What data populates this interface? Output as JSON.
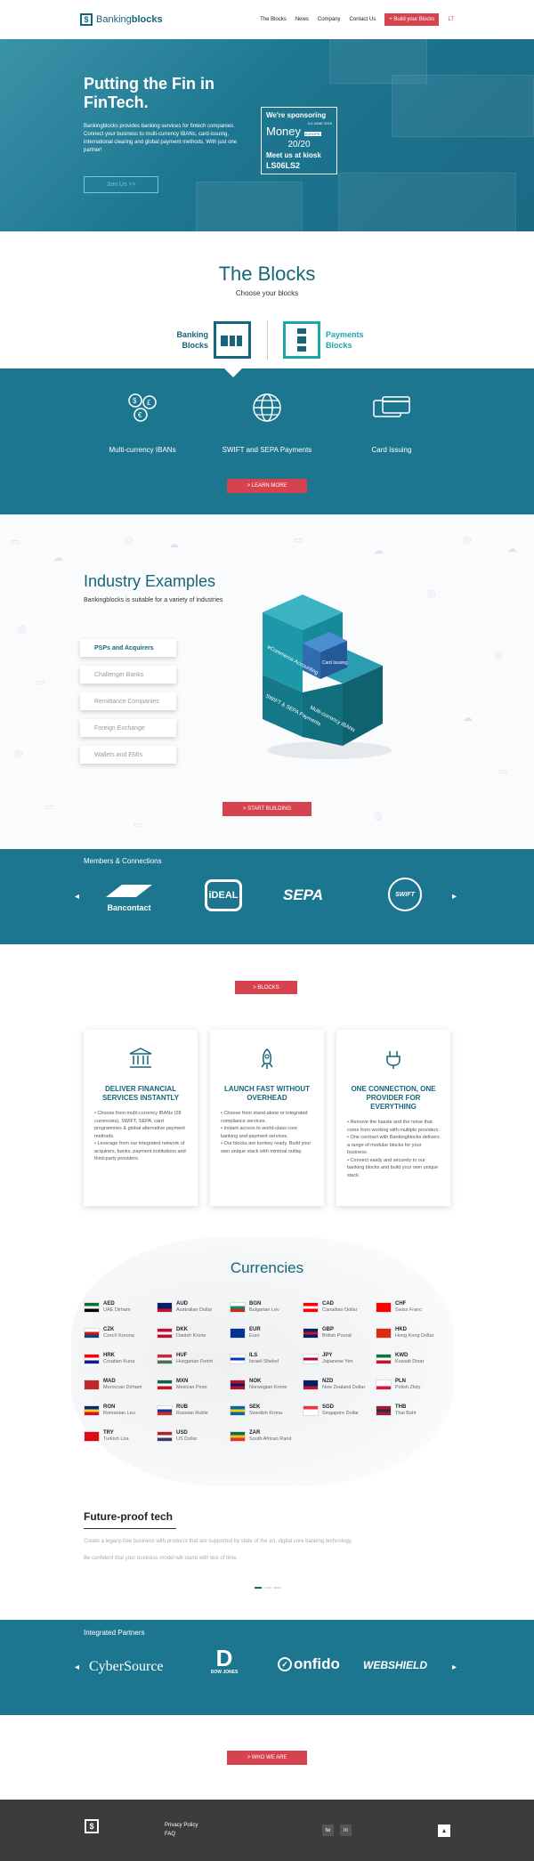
{
  "nav": {
    "logo_light": "Banking",
    "logo_bold": "blocks",
    "links": [
      "The Blocks",
      "News",
      "Company",
      "Contact Us"
    ],
    "cta": "+ Build your Blocks",
    "lang": "LT"
  },
  "hero": {
    "title": "Putting the Fin in FinTech.",
    "text": "Bankingblocks provides banking services for fintech companies. Connect your business to multi-currency IBANs, card-issuing, international clearing and global payment methods. With just one partner!",
    "button": "Join Us >>",
    "badge": {
      "line1": "We're sponsoring",
      "date": "3-6 JUNE 2019",
      "money": "Money",
      "europe": "EUROPE",
      "year": "20/20",
      "kiosk_label": "Meet us at kiosk",
      "kiosk": "LS06LS2"
    }
  },
  "blocks": {
    "title": "The Blocks",
    "subtitle": "Choose your blocks",
    "banking_label": "Banking Blocks",
    "payments_label": "Payments Blocks",
    "features": [
      {
        "label": "Multi-currency IBANs",
        "icon": "coins-icon"
      },
      {
        "label": "SWIFT and SEPA Payments",
        "icon": "globe-icon"
      },
      {
        "label": "Card Issuing",
        "icon": "cards-icon"
      }
    ],
    "learn_more": "> LEARN MORE"
  },
  "industry": {
    "title": "Industry Examples",
    "subtitle": "Bankingblocks is suitable for a variety of industries",
    "items": [
      "PSPs and Acquirers",
      "Challenger Banks",
      "Remittance Companies",
      "Foreign Exchange",
      "Wallets and EMIs"
    ],
    "cube_labels": [
      "eCommerce Accounting",
      "Card Issuing",
      "SWIFT & SEPA Payments",
      "Multi-currency IBANs"
    ],
    "start_button": "> START BUILDING"
  },
  "members": {
    "title": "Members & Connections",
    "logos": [
      "Bancontact",
      "iDEAL",
      "SEPA",
      "SWIFT"
    ]
  },
  "blocks_button": "> BLOCKS",
  "cards": [
    {
      "title": "DELIVER FINANCIAL SERVICES INSTANTLY",
      "icon": "bank-icon",
      "body": "• Choose from multi-currency IBANs (28 currencies), SWIFT, SEPA, card programmes & global alternative payment methods.\n• Leverage from our integrated network of acquirers, banks, payment institutions and third-party providers."
    },
    {
      "title": "LAUNCH FAST WITHOUT OVERHEAD",
      "icon": "rocket-icon",
      "body": "• Choose from stand-alone or integrated compliance services.\n• Instant access to world-class core banking and payment services.\n• Our blocks are turnkey ready. Build your own unique stack with minimal outlay."
    },
    {
      "title": "ONE CONNECTION, ONE PROVIDER FOR EVERYTHING",
      "icon": "plug-icon",
      "body": "• Remove the hassle and the noise that come from working with multiple providers.\n• One contract with Bankingblocks delivers a range of modular blocks for your business.\n• Connect easily and securely to our banking blocks and build your own unique stack."
    }
  ],
  "currencies": {
    "title": "Currencies",
    "list": [
      {
        "code": "AED",
        "name": "UAE Dirham",
        "c1": "#00732f",
        "c2": "#ffffff",
        "c3": "#000000"
      },
      {
        "code": "AUD",
        "name": "Australian Dollar",
        "c1": "#012169",
        "c2": "#012169",
        "c3": "#c8102e"
      },
      {
        "code": "BGN",
        "name": "Bulgarian Lev",
        "c1": "#ffffff",
        "c2": "#00966e",
        "c3": "#d62612"
      },
      {
        "code": "CAD",
        "name": "Canadian Dollar",
        "c1": "#ff0000",
        "c2": "#ffffff",
        "c3": "#ff0000"
      },
      {
        "code": "CHF",
        "name": "Swiss Franc",
        "c1": "#ff0000",
        "c2": "#ff0000",
        "c3": "#ff0000"
      },
      {
        "code": "CZK",
        "name": "Czech Koruna",
        "c1": "#ffffff",
        "c2": "#d7141a",
        "c3": "#11457e"
      },
      {
        "code": "DKK",
        "name": "Danish Krone",
        "c1": "#c60c30",
        "c2": "#ffffff",
        "c3": "#c60c30"
      },
      {
        "code": "EUR",
        "name": "Euro",
        "c1": "#003399",
        "c2": "#003399",
        "c3": "#003399"
      },
      {
        "code": "GBP",
        "name": "British Pound",
        "c1": "#012169",
        "c2": "#c8102e",
        "c3": "#012169"
      },
      {
        "code": "HKD",
        "name": "Hong Kong Dollar",
        "c1": "#de2910",
        "c2": "#de2910",
        "c3": "#de2910"
      },
      {
        "code": "HRK",
        "name": "Croatian Kuna",
        "c1": "#ff0000",
        "c2": "#ffffff",
        "c3": "#171796"
      },
      {
        "code": "HUF",
        "name": "Hungarian Forint",
        "c1": "#ce2939",
        "c2": "#ffffff",
        "c3": "#477050"
      },
      {
        "code": "ILS",
        "name": "Israeli Shekel",
        "c1": "#ffffff",
        "c2": "#0038b8",
        "c3": "#ffffff"
      },
      {
        "code": "JPY",
        "name": "Japanese Yen",
        "c1": "#ffffff",
        "c2": "#bc002d",
        "c3": "#ffffff"
      },
      {
        "code": "KWD",
        "name": "Kuwaiti Dinar",
        "c1": "#007a3d",
        "c2": "#ffffff",
        "c3": "#ce1126"
      },
      {
        "code": "MAD",
        "name": "Moroccan Dirham",
        "c1": "#c1272d",
        "c2": "#c1272d",
        "c3": "#c1272d"
      },
      {
        "code": "MXN",
        "name": "Mexican Peso",
        "c1": "#006847",
        "c2": "#ffffff",
        "c3": "#ce1126"
      },
      {
        "code": "NOK",
        "name": "Norwegian Krone",
        "c1": "#ba0c2f",
        "c2": "#00205b",
        "c3": "#ba0c2f"
      },
      {
        "code": "NZD",
        "name": "New Zealand Dollar",
        "c1": "#012169",
        "c2": "#012169",
        "c3": "#c8102e"
      },
      {
        "code": "PLN",
        "name": "Polish Zloty",
        "c1": "#ffffff",
        "c2": "#ffffff",
        "c3": "#dc143c"
      },
      {
        "code": "RON",
        "name": "Romanian Leu",
        "c1": "#002b7f",
        "c2": "#fcd116",
        "c3": "#ce1126"
      },
      {
        "code": "RUB",
        "name": "Russian Ruble",
        "c1": "#ffffff",
        "c2": "#0039a6",
        "c3": "#d52b1e"
      },
      {
        "code": "SEK",
        "name": "Swedish Krona",
        "c1": "#006aa7",
        "c2": "#fecc00",
        "c3": "#006aa7"
      },
      {
        "code": "SGD",
        "name": "Singapore Dollar",
        "c1": "#ef3340",
        "c2": "#ffffff",
        "c3": "#ffffff"
      },
      {
        "code": "THB",
        "name": "Thai Baht",
        "c1": "#a51931",
        "c2": "#2d2a4a",
        "c3": "#a51931"
      },
      {
        "code": "TRY",
        "name": "Turkish Lira",
        "c1": "#e30a17",
        "c2": "#e30a17",
        "c3": "#e30a17"
      },
      {
        "code": "USD",
        "name": "US Dollar",
        "c1": "#b22234",
        "c2": "#ffffff",
        "c3": "#3c3b6e"
      },
      {
        "code": "ZAR",
        "name": "South African Rand",
        "c1": "#007749",
        "c2": "#ffb81c",
        "c3": "#de3831"
      }
    ]
  },
  "future": {
    "title": "Future-proof tech",
    "p1": "Create a legacy-free business with products that are supported by state of the art, digital core banking technology.",
    "p2": "Be confident that your business model will stand with test of time."
  },
  "partners": {
    "title": "Integrated Partners",
    "logos": [
      "CyberSource",
      "DOW JONES",
      "onfido",
      "WEBSHIELD"
    ]
  },
  "who_button": "> WHO WE ARE",
  "footer": {
    "links": [
      "Privacy Policy",
      "FAQ"
    ],
    "social": [
      "tw",
      "in"
    ]
  },
  "colors": {
    "teal": "#1d7690",
    "accent_red": "#d6434f",
    "dark_teal": "#17657a"
  }
}
